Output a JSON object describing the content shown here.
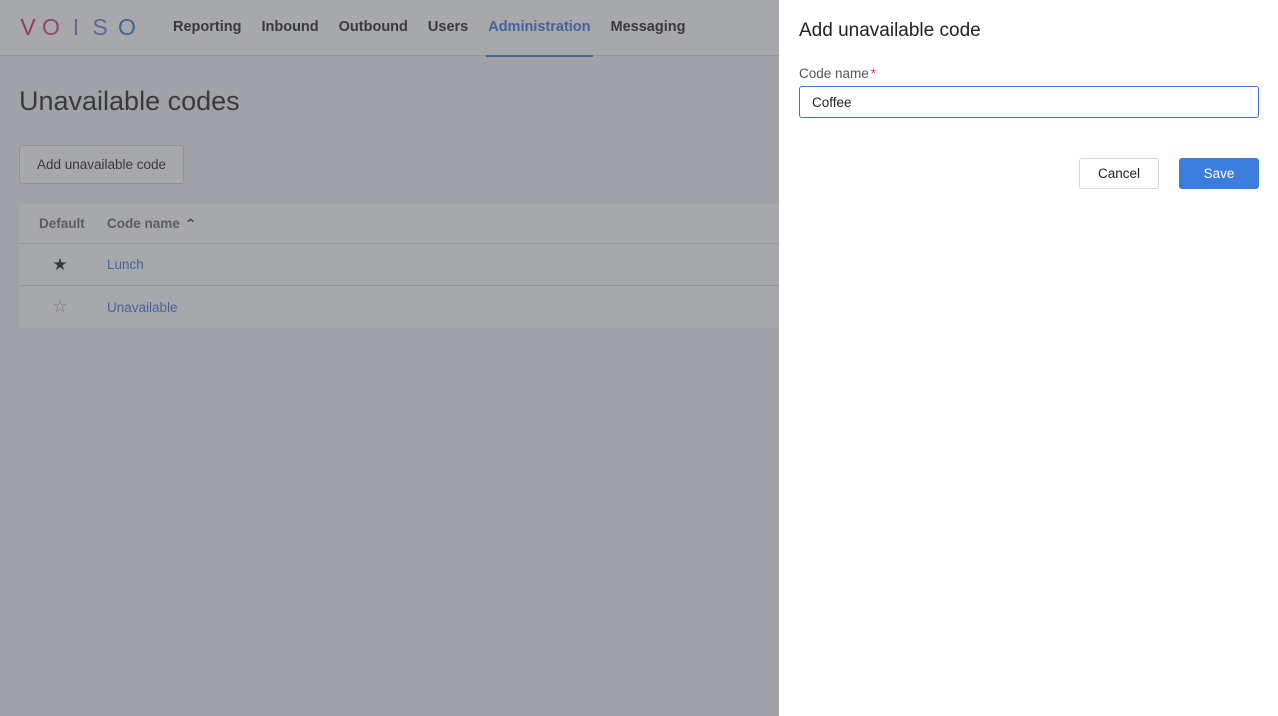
{
  "brand": {
    "logo_letters": [
      "V",
      "O",
      "I",
      "S",
      "O"
    ],
    "accent_color": "#3b74d9"
  },
  "nav": {
    "items": [
      {
        "label": "Reporting",
        "active": false
      },
      {
        "label": "Inbound",
        "active": false
      },
      {
        "label": "Outbound",
        "active": false
      },
      {
        "label": "Users",
        "active": false
      },
      {
        "label": "Administration",
        "active": true
      },
      {
        "label": "Messaging",
        "active": false
      }
    ]
  },
  "page": {
    "title": "Unavailable codes",
    "add_button_label": "Add unavailable code"
  },
  "table": {
    "columns": [
      {
        "label": "Default"
      },
      {
        "label": "Code name",
        "sort": "ascending",
        "sort_icon": "chevron-up-icon"
      }
    ],
    "rows": [
      {
        "default": true,
        "star_icon": "star-filled-icon",
        "code_name": "Lunch"
      },
      {
        "default": false,
        "star_icon": "star-outline-icon",
        "code_name": "Unavailable"
      }
    ]
  },
  "drawer": {
    "title": "Add unavailable code",
    "field_label": "Code name",
    "required_marker": "*",
    "field_value": "Coffee",
    "cancel_label": "Cancel",
    "save_label": "Save",
    "save_color": "#3b7ddd"
  }
}
